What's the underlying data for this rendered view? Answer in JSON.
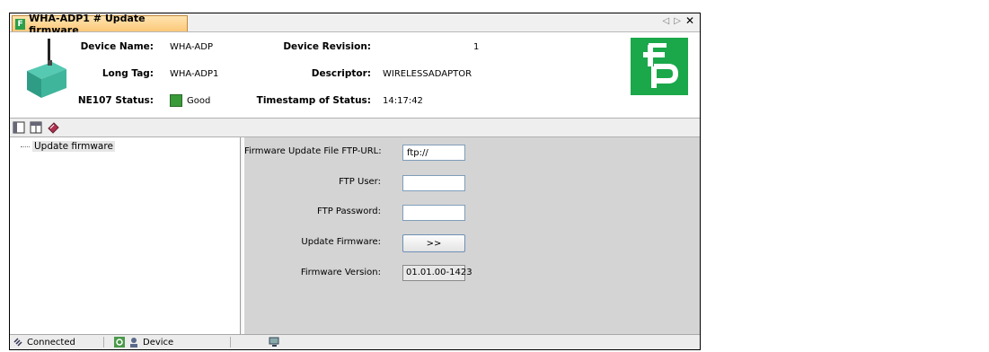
{
  "tab": {
    "title": "WHA-ADP1 # Update firmware",
    "logo_letter": "F"
  },
  "header": {
    "device_name_label": "Device Name:",
    "device_name": "WHA-ADP",
    "long_tag_label": "Long Tag:",
    "long_tag": "WHA-ADP1",
    "ne107_label": "NE107 Status:",
    "ne107_status": "Good",
    "ne107_color": "#3a9a3a",
    "revision_label": "Device Revision:",
    "revision": "1",
    "descriptor_label": "Descriptor:",
    "descriptor": "WIRELESSADAPTOR",
    "timestamp_label": "Timestamp of Status:",
    "timestamp": "14:17:42",
    "brand_color": "#1aa84a"
  },
  "toolbar": {
    "icons": [
      "layout-left-icon",
      "layout-top-icon",
      "book-icon"
    ]
  },
  "tree": {
    "items": [
      {
        "label": "Update firmware"
      }
    ]
  },
  "form": {
    "ftp_url_label": "Firmware Update File FTP-URL:",
    "ftp_url_value": "ftp://",
    "ftp_user_label": "FTP User:",
    "ftp_user_value": "",
    "ftp_password_label": "FTP Password:",
    "ftp_password_value": "",
    "update_label": "Update Firmware:",
    "update_button": ">>",
    "version_label": "Firmware Version:",
    "version_value": "01.01.00-1423"
  },
  "statusbar": {
    "connection": "Connected",
    "device": "Device"
  }
}
